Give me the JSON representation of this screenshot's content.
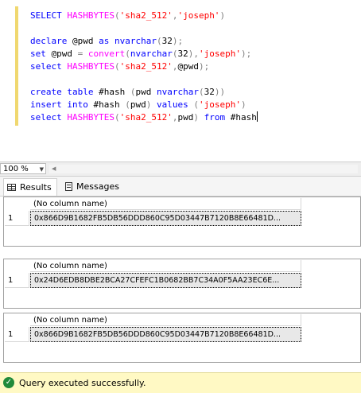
{
  "editor": {
    "lines": [
      [
        {
          "t": "SELECT ",
          "c": "kw"
        },
        {
          "t": "HASHBYTES",
          "c": "fn"
        },
        {
          "t": "(",
          "c": "gr"
        },
        {
          "t": "'sha2_512'",
          "c": "str"
        },
        {
          "t": ",",
          "c": "gr"
        },
        {
          "t": "'joseph'",
          "c": "str"
        },
        {
          "t": ")",
          "c": "gr"
        }
      ],
      [],
      [
        {
          "t": "declare ",
          "c": "kw"
        },
        {
          "t": "@pwd ",
          "c": "bk"
        },
        {
          "t": "as ",
          "c": "kw"
        },
        {
          "t": "nvarchar",
          "c": "kw"
        },
        {
          "t": "(",
          "c": "gr"
        },
        {
          "t": "32",
          "c": "bk"
        },
        {
          "t": ");",
          "c": "gr"
        }
      ],
      [
        {
          "t": "set ",
          "c": "kw"
        },
        {
          "t": "@pwd ",
          "c": "bk"
        },
        {
          "t": "= ",
          "c": "gr"
        },
        {
          "t": "convert",
          "c": "fn"
        },
        {
          "t": "(",
          "c": "gr"
        },
        {
          "t": "nvarchar",
          "c": "kw"
        },
        {
          "t": "(",
          "c": "gr"
        },
        {
          "t": "32",
          "c": "bk"
        },
        {
          "t": "),",
          "c": "gr"
        },
        {
          "t": "'joseph'",
          "c": "str"
        },
        {
          "t": ");",
          "c": "gr"
        }
      ],
      [
        {
          "t": "select ",
          "c": "kw"
        },
        {
          "t": "HASHBYTES",
          "c": "fn"
        },
        {
          "t": "(",
          "c": "gr"
        },
        {
          "t": "'sha2_512'",
          "c": "str"
        },
        {
          "t": ",",
          "c": "gr"
        },
        {
          "t": "@pwd",
          "c": "bk"
        },
        {
          "t": ");",
          "c": "gr"
        }
      ],
      [],
      [
        {
          "t": "create ",
          "c": "kw"
        },
        {
          "t": "table ",
          "c": "kw"
        },
        {
          "t": "#hash ",
          "c": "bk"
        },
        {
          "t": "(",
          "c": "gr"
        },
        {
          "t": "pwd ",
          "c": "bk"
        },
        {
          "t": "nvarchar",
          "c": "kw"
        },
        {
          "t": "(",
          "c": "gr"
        },
        {
          "t": "32",
          "c": "bk"
        },
        {
          "t": "))",
          "c": "gr"
        }
      ],
      [
        {
          "t": "insert ",
          "c": "kw"
        },
        {
          "t": "into ",
          "c": "kw"
        },
        {
          "t": "#hash ",
          "c": "bk"
        },
        {
          "t": "(",
          "c": "gr"
        },
        {
          "t": "pwd",
          "c": "bk"
        },
        {
          "t": ") ",
          "c": "gr"
        },
        {
          "t": "values ",
          "c": "kw"
        },
        {
          "t": "(",
          "c": "gr"
        },
        {
          "t": "'joseph'",
          "c": "str"
        },
        {
          "t": ")",
          "c": "gr"
        }
      ],
      [
        {
          "t": "select ",
          "c": "kw"
        },
        {
          "t": "HASHBYTES",
          "c": "fn"
        },
        {
          "t": "(",
          "c": "gr"
        },
        {
          "t": "'sha2_512'",
          "c": "str"
        },
        {
          "t": ",",
          "c": "gr"
        },
        {
          "t": "pwd",
          "c": "bk"
        },
        {
          "t": ") ",
          "c": "gr"
        },
        {
          "t": "from ",
          "c": "kw"
        },
        {
          "t": "#hash",
          "c": "bk"
        }
      ]
    ],
    "colors": {
      "kw": "#0000ff",
      "fn": "#ff00ff",
      "str": "#ff0000",
      "gr": "#808080",
      "bk": "#000000"
    }
  },
  "zoom": {
    "value": "100 %"
  },
  "tabs": {
    "results_label": "Results",
    "messages_label": "Messages"
  },
  "result_grids": [
    {
      "header": "(No column name)",
      "row_number": "1",
      "value": "0x866D9B1682FB5DB56DDD860C95D03447B7120B8E66481D..."
    },
    {
      "header": "(No column name)",
      "row_number": "1",
      "value": "0x24D6EDB8DBE2BCA27CFEFC1B0682BB7C34A0F5AA23EC6E..."
    },
    {
      "header": "(No column name)",
      "row_number": "1",
      "value": "0x866D9B1682FB5DB56DDD860C95D03447B7120B8E66481D..."
    }
  ],
  "status": {
    "text": "Query executed successfully.",
    "icon": "check-circle-icon",
    "color": "#fff9c4"
  }
}
